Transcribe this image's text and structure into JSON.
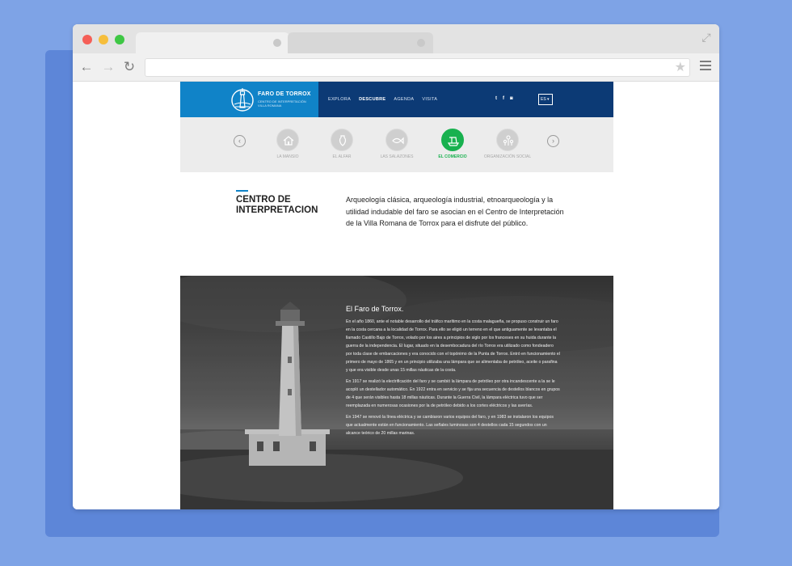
{
  "site": {
    "logo": {
      "title": "FARO DE TORROX",
      "subtitle": "CENTRO DE INTERPRETACIÓN VILLA ROMANA"
    },
    "nav": [
      {
        "label": "EXPLORA",
        "active": false
      },
      {
        "label": "DESCUBRE",
        "active": true
      },
      {
        "label": "AGENDA",
        "active": false
      },
      {
        "label": "VISITA",
        "active": false
      }
    ],
    "social": [
      "twitter-icon",
      "facebook-icon",
      "instagram-icon"
    ],
    "language": "ES",
    "carousel": [
      {
        "label": "LA MANSIO",
        "icon": "villa-icon",
        "active": false
      },
      {
        "label": "EL ALFAR",
        "icon": "amphora-icon",
        "active": false
      },
      {
        "label": "LAS SALAZONES",
        "icon": "fish-icon",
        "active": false
      },
      {
        "label": "EL COMERCIO",
        "icon": "ship-icon",
        "active": true
      },
      {
        "label": "ORGANIZACIÓN SOCIAL",
        "icon": "people-icon",
        "active": false
      }
    ],
    "intro": {
      "title": "CENTRO DE INTERPRETACION",
      "text": "Arqueología clásica, arqueología industrial, etnoarqueología y la utilidad indudable del faro se asocian en el Centro de Interpretación de la Villa Romana de Torrox para el disfrute del público."
    },
    "faro": {
      "title": "El Faro de Torrox.",
      "paragraphs": [
        "En el año 1860, ante el notable desarrollo del tráfico marítimo en la costa malagueña, se propuso construir un faro en la costa cercana a la localidad de Torrox. Para ello se eligió un terreno en el que antiguamente se levantaba el llamado Castillo Bajo de Torrox, volado por los aires a principios de siglo por los franceses en su huida durante la guerra de la independencia. El lugar, situado en la desembocadura del río Torrox era utilizado como fondeadero por toda clase de embarcaciones y era conocido con el topónimo de la Punta de Torrox. Entró en funcionamiento el primero de mayo de 1865 y en un principio utilizaba una lámpara que se alimentaba de petróleo, aceite o parafina y que era visible desde unas 15 millas náuticas de la costa.",
        "En 1917 se realizó la electrificación del faro y se cambió la lámpara de petróleo por otra incandescente a la se le acopló un destellador automático. En 1922 entra en servicio y se fija una secuencia de destellos blancos en grupos de 4 que serán visibles hasta 18 millas náuticas. Durante la Guerra Civil, la lámpara eléctrica tuvo que ser reemplazada en numerosas ocasiones por la de petróleo debido a los cortes eléctricos y las averías.",
        "En 1947 se renovó la línea eléctrica y se cambiaron varios equipos del faro, y en 1983 se instalaron los equipos que actualmente están en funcionamiento. Las señales luminosas son 4 destellos cada 15 segundos con un alcance teórico de 20 millas marinas."
      ]
    }
  }
}
